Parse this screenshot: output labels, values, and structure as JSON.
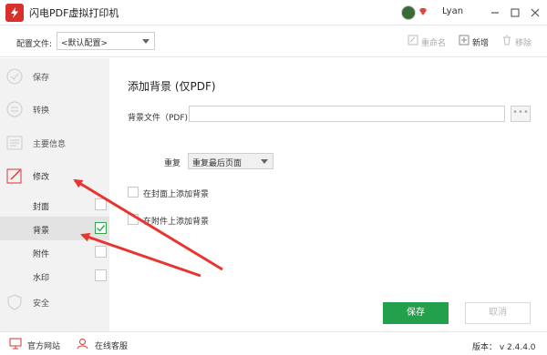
{
  "app": {
    "title": "闪电PDF虚拟打印机",
    "user": "Lyan"
  },
  "config": {
    "label": "配置文件:",
    "selected": "<默认配置>",
    "rename": "重命名",
    "new": "新增",
    "remove": "移除"
  },
  "sidebar": {
    "items": [
      {
        "label": "保存",
        "icon": "save-icon"
      },
      {
        "label": "转换",
        "icon": "convert-icon"
      },
      {
        "label": "主要信息",
        "icon": "info-icon"
      },
      {
        "label": "修改",
        "icon": "edit-icon"
      },
      {
        "label": "安全",
        "icon": "shield-icon"
      }
    ],
    "subitems": [
      {
        "label": "封面",
        "checked": false
      },
      {
        "label": "背景",
        "checked": true
      },
      {
        "label": "附件",
        "checked": false
      },
      {
        "label": "水印",
        "checked": false
      }
    ]
  },
  "main": {
    "heading": "添加背景 (仅PDF)",
    "bgfile_label": "背景文件（PDF)",
    "bgfile_value": "",
    "browse": "•••",
    "repeat_label": "重复",
    "repeat_value": "重复最后页面",
    "option_cover": "在封面上添加背景",
    "option_attachment": "在附件上添加背景",
    "save": "保存",
    "cancel": "取消"
  },
  "footer": {
    "website": "官方网站",
    "service": "在线客服",
    "version": "版本： v 2.4.4.0"
  },
  "colors": {
    "accent": "#23a04c",
    "brand": "#d9302b",
    "arrow": "#e8352f"
  }
}
